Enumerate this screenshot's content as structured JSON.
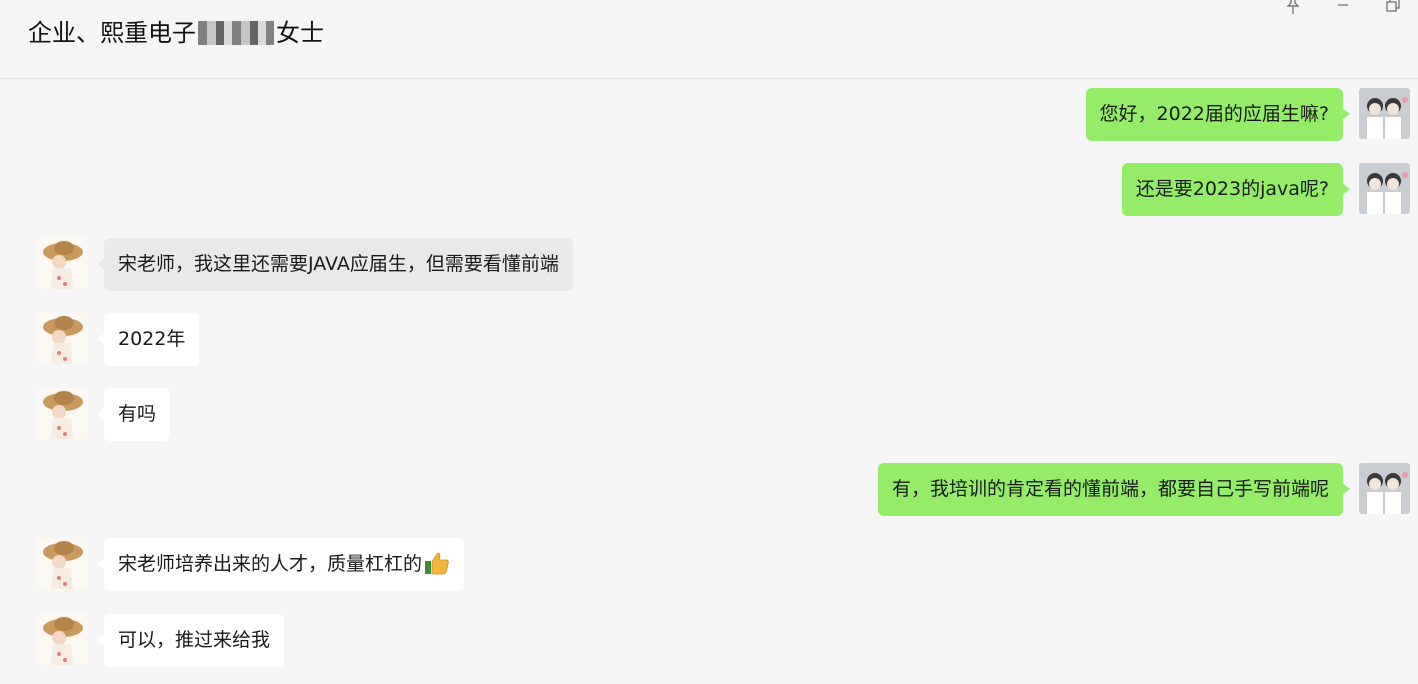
{
  "header": {
    "title_prefix": "企业、熙重电子",
    "title_suffix": "女士"
  },
  "window_controls": {
    "pin_icon": "pin-icon",
    "minimize_icon": "minimize-icon",
    "restore_icon": "restore-icon"
  },
  "colors": {
    "my_bubble": "#95ec69",
    "their_bubble": "#ffffff",
    "background": "#f5f5f5"
  },
  "messages": [
    {
      "side": "right",
      "text": "您好，2022届的应届生嘛?"
    },
    {
      "side": "right",
      "text": "还是要2023的java呢?"
    },
    {
      "side": "left",
      "text": "宋老师，我这里还需要JAVA应届生，但需要看懂前端"
    },
    {
      "side": "left",
      "text": "2022年"
    },
    {
      "side": "left",
      "text": "有吗"
    },
    {
      "side": "right",
      "text": "有，我培训的肯定看的懂前端，都要自己手写前端呢"
    },
    {
      "side": "left",
      "text": "宋老师培养出来的人才，质量杠杠的",
      "emoji": "thumbs-up-icon"
    },
    {
      "side": "left",
      "text": "可以，推过来给我"
    }
  ]
}
